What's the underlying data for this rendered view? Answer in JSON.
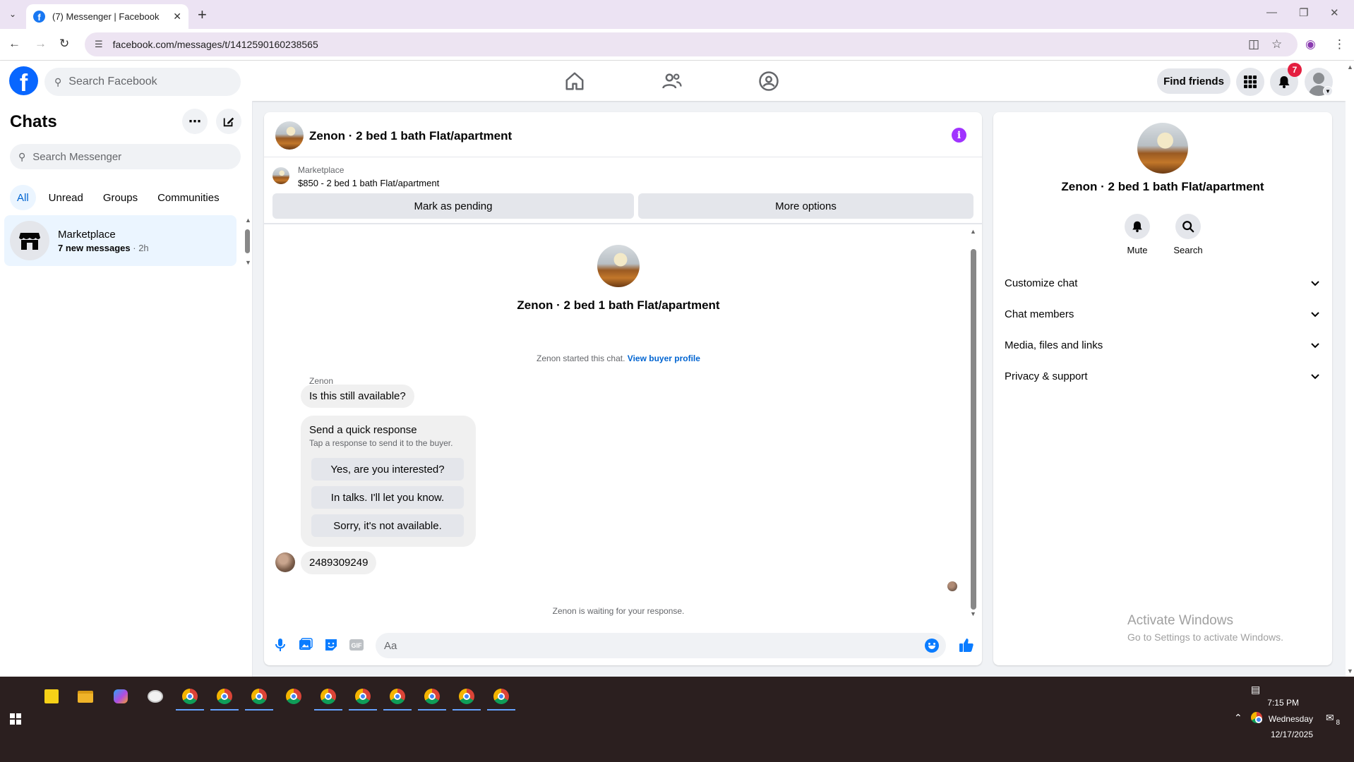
{
  "browser": {
    "tab_title": "(7) Messenger | Facebook",
    "url": "facebook.com/messages/t/1412590160238565"
  },
  "fb_header": {
    "search_placeholder": "Search Facebook",
    "find_friends": "Find friends",
    "notification_count": "7"
  },
  "sidebar": {
    "title": "Chats",
    "search_placeholder": "Search Messenger",
    "filters": [
      "All",
      "Unread",
      "Groups",
      "Communities"
    ],
    "active_filter": "All",
    "chats": [
      {
        "name": "Marketplace",
        "preview": "7 new messages",
        "time": "· 2h",
        "icon": "marketplace-store-icon"
      }
    ]
  },
  "conversation": {
    "title": "Zenon · 2 bed 1 bath Flat/apartment",
    "marketplace_label": "Marketplace",
    "listing": "$850 - 2 bed 1 bath Flat/apartment",
    "mark_pending": "Mark as pending",
    "more_options": "More options",
    "thread_title": "Zenon · 2 bed 1 bath Flat/apartment",
    "started_text": "Zenon started this chat.",
    "buyer_profile_link": "View buyer profile",
    "sender_name": "Zenon",
    "first_message": "Is this still available?",
    "quick_response": {
      "title": "Send a quick response",
      "subtitle": "Tap a response to send it to the buyer.",
      "options": [
        "Yes, are you interested?",
        "In talks. I'll let you know.",
        "Sorry, it's not available."
      ]
    },
    "second_message": "2489309249",
    "waiting_text": "Zenon is waiting for your response.",
    "composer_placeholder": "Aa"
  },
  "info_panel": {
    "title": "Zenon · 2 bed 1 bath Flat/apartment",
    "actions": [
      {
        "label": "Mute",
        "icon": "bell-icon"
      },
      {
        "label": "Search",
        "icon": "search-icon"
      }
    ],
    "sections": [
      "Customize chat",
      "Chat members",
      "Media, files and links",
      "Privacy & support"
    ]
  },
  "watermark": {
    "line1": "Activate Windows",
    "line2": "Go to Settings to activate Windows."
  },
  "taskbar": {
    "time": "7:15 PM",
    "day": "Wednesday",
    "date": "12/17/2025",
    "notification_count": "8"
  },
  "colors": {
    "facebook_blue": "#0866ff",
    "messenger_accent": "#0a7cff",
    "info_purple": "#a033ff",
    "badge_red": "#e41e3f"
  }
}
